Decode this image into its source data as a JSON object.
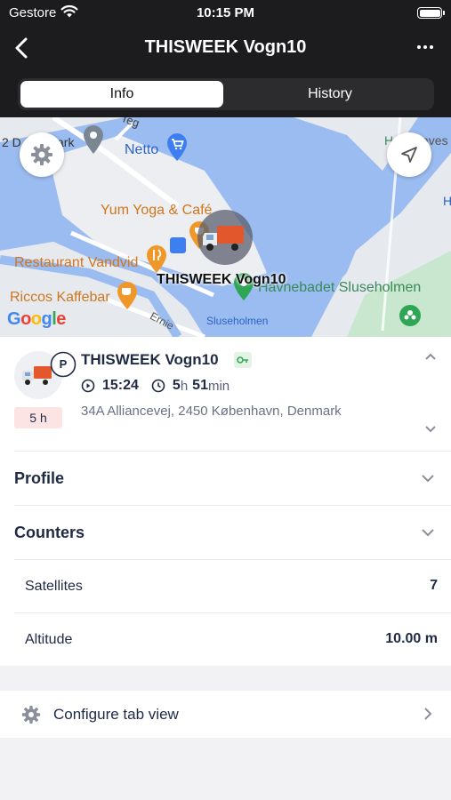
{
  "status_bar": {
    "carrier": "Gestore",
    "time": "10:15 PM"
  },
  "header": {
    "title": "THISWEEK Vogn10"
  },
  "tabs": [
    {
      "label": "Info",
      "active": true
    },
    {
      "label": "History",
      "active": false
    }
  ],
  "map": {
    "places": {
      "netto": "Netto",
      "yum": "Yum Yoga & Café",
      "restaurant": "Restaurant Vandvid",
      "riccos": "Riccos Kaffebar",
      "havnebadet": "Havnebadet Sluseholmen",
      "sluseholmen": "Sluseholmen",
      "ernie": "Ernie",
      "topleft": "2 D",
      "topleft2": "ark",
      "teg": "Teg",
      "right_top": "H",
      "right_top2": "aves",
      "right_h": "H"
    },
    "vehicle_label": "THISWEEK Vogn10",
    "attribution": "Google",
    "colors": {
      "water": "#9bbcf0",
      "land": "#e6e9ee",
      "park": "#c9e7cf"
    }
  },
  "vehicle": {
    "name": "THISWEEK Vogn10",
    "parking_badge": "P",
    "duration_badge": "5 h",
    "time": "15:24",
    "elapsed_hours": "5",
    "elapsed_hours_unit": "h",
    "elapsed_minutes": "51",
    "elapsed_minutes_unit": "min",
    "address": "34A Alliancevej, 2450 København, Denmark"
  },
  "sections": {
    "profile": "Profile",
    "counters": "Counters"
  },
  "counters": [
    {
      "label": "Satellites",
      "value": "7"
    },
    {
      "label": "Altitude",
      "value": "10.00 m"
    }
  ],
  "config": {
    "label": "Configure tab view"
  }
}
